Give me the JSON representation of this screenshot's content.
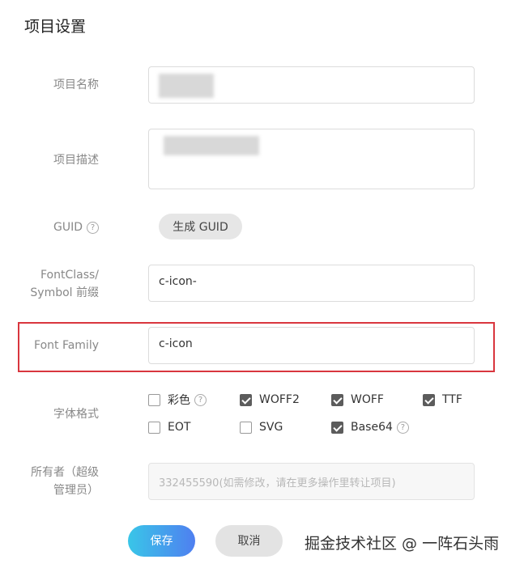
{
  "page": {
    "title": "项目设置"
  },
  "form": {
    "name": {
      "label": "项目名称",
      "value": ""
    },
    "description": {
      "label": "项目描述",
      "value": ""
    },
    "guid": {
      "label": "GUID",
      "button": "生成 GUID",
      "help": "?"
    },
    "fontclass": {
      "label_line1": "FontClass/",
      "label_line2": "Symbol 前缀",
      "value": "c-icon-"
    },
    "font_family": {
      "label": "Font Family",
      "value": "c-icon"
    },
    "font_format": {
      "label": "字体格式",
      "options": [
        {
          "label": "彩色",
          "checked": false,
          "help": "?"
        },
        {
          "label": "WOFF2",
          "checked": true
        },
        {
          "label": "WOFF",
          "checked": true
        },
        {
          "label": "TTF",
          "checked": true
        },
        {
          "label": "EOT",
          "checked": false
        },
        {
          "label": "SVG",
          "checked": false
        },
        {
          "label": "Base64",
          "checked": true,
          "help": "?"
        }
      ]
    },
    "owner": {
      "label_line1": "所有者（超级",
      "label_line2": "管理员）",
      "value": "332455590(如需修改，请在更多操作里转让项目)"
    }
  },
  "actions": {
    "save": "保存",
    "cancel": "取消"
  },
  "watermark": "掘金技术社区 @ 一阵石头雨",
  "colors": {
    "highlight": "#d9363e",
    "save_start": "#39c6e8",
    "save_end": "#4f7ff0"
  }
}
